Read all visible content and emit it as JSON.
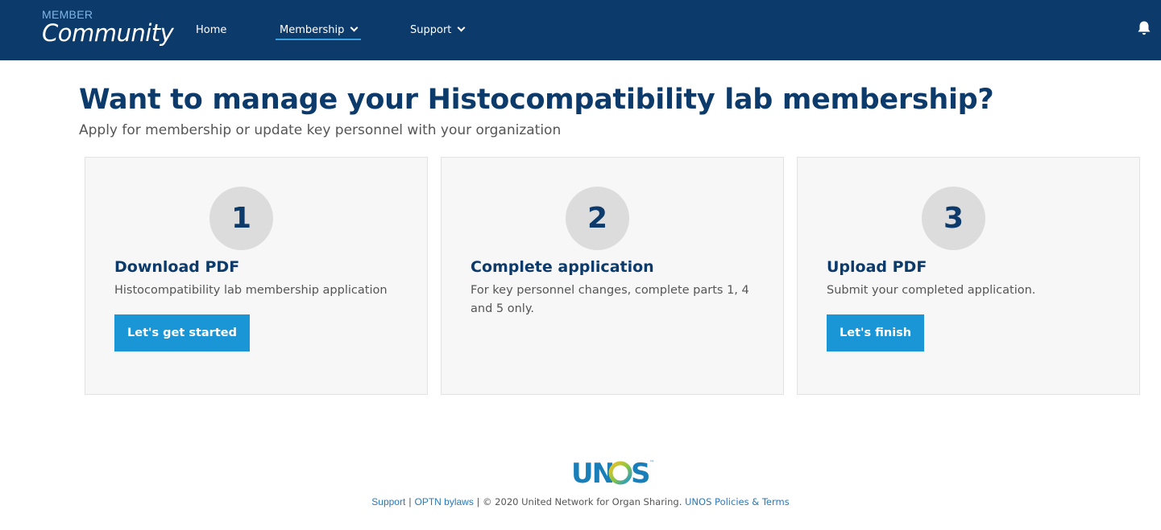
{
  "header": {
    "logo_small": "MEMBER",
    "logo_big": "Community",
    "nav": {
      "home": "Home",
      "membership": "Membership",
      "support": "Support"
    },
    "bell_icon": "bell-icon",
    "colors": {
      "bar": "#0b3a6b",
      "active_underline": "#3aa0e0"
    }
  },
  "main": {
    "title": "Want to manage your Histocompatibility lab membership?",
    "subtitle": "Apply for membership or update key personnel with your organization",
    "steps": [
      {
        "number": "1",
        "title": "Download PDF",
        "description": "Histocompatibility lab membership application",
        "button": "Let's get started"
      },
      {
        "number": "2",
        "title": "Complete application",
        "description": "For key personnel changes, complete parts 1, 4 and 5 only."
      },
      {
        "number": "3",
        "title": "Upload PDF",
        "description": "Submit your completed application.",
        "button": "Let's finish"
      }
    ],
    "colors": {
      "button": "#1a96d6",
      "heading": "#0b3a6b"
    }
  },
  "footer": {
    "logo_text": "UNOS",
    "support": "Support",
    "sep1": " | ",
    "bylaws": "OPTN bylaws",
    "copyright": " | © 2020 United Network for Organ Sharing. ",
    "policies": "UNOS Policies & Terms"
  }
}
